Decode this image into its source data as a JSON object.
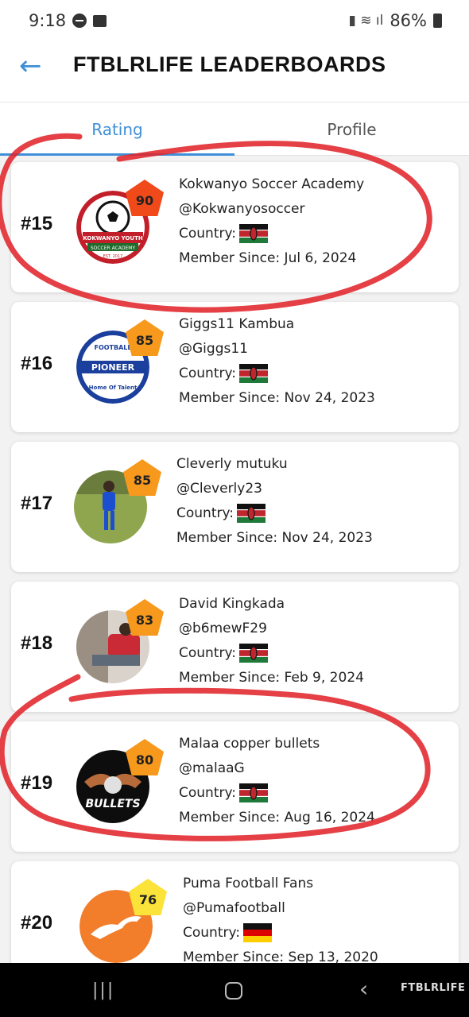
{
  "status_bar": {
    "time": "9:18",
    "battery": "86%"
  },
  "header": {
    "title": "FTBLRLIFE LEADERBOARDS",
    "back_icon": "arrow-left-icon"
  },
  "tabs": [
    {
      "label": "Rating",
      "active": true
    },
    {
      "label": "Profile",
      "active": false
    }
  ],
  "entries": [
    {
      "rank": "#15",
      "rating": "90",
      "badge_color": "#f04a1b",
      "name": "Kokwanyo Soccer Academy",
      "handle": "@Kokwanyosoccer",
      "country_label": "Country:",
      "country": "Kenya",
      "member_since": "Member Since: Jul 6, 2024",
      "avatar_text": "KOKWANYO YOUTH SOCCER ACADEMY EST. 2017"
    },
    {
      "rank": "#16",
      "rating": "85",
      "badge_color": "#f7991c",
      "name": "Giggs11 Kambua",
      "handle": "@Giggs11",
      "country_label": "Country:",
      "country": "Kenya",
      "member_since": "Member Since: Nov 24, 2023",
      "avatar_text": "FOOTBALL PIONEER Home Of Talent"
    },
    {
      "rank": "#17",
      "rating": "85",
      "badge_color": "#f7991c",
      "name": "Cleverly mutuku",
      "handle": "@Cleverly23",
      "country_label": "Country:",
      "country": "Kenya",
      "member_since": "Member Since: Nov 24, 2023"
    },
    {
      "rank": "#18",
      "rating": "83",
      "badge_color": "#f7991c",
      "name": "David Kingkada",
      "handle": "@b6mewF29",
      "country_label": "Country:",
      "country": "Kenya",
      "member_since": "Member Since: Feb 9, 2024"
    },
    {
      "rank": "#19",
      "rating": "80",
      "badge_color": "#f7991c",
      "name": "Malaa copper bullets",
      "handle": "@malaaG",
      "country_label": "Country:",
      "country": "Kenya",
      "member_since": "Member Since: Aug 16, 2024",
      "avatar_text": "BULLETS"
    },
    {
      "rank": "#20",
      "rating": "76",
      "badge_color": "#fbe33a",
      "name": "Puma Football Fans",
      "handle": "@Pumafootball",
      "country_label": "Country:",
      "country": "Germany",
      "member_since": "Member Since: Sep 13, 2020"
    }
  ],
  "navbar": {
    "logo": "FTBLRLIFE"
  },
  "colors": {
    "accent": "#3f8fd8",
    "annotation": "#e0262b"
  }
}
